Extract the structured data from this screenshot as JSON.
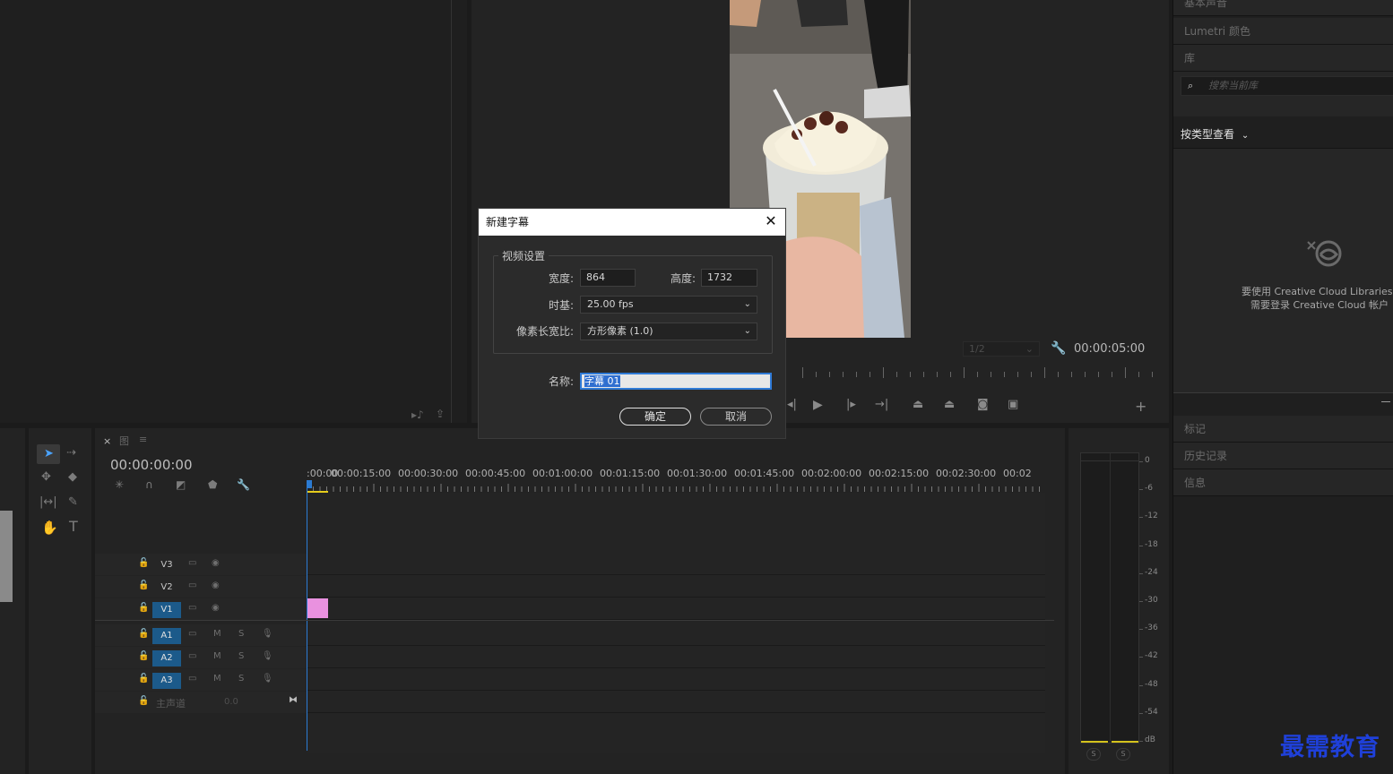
{
  "program_monitor": {
    "timecode": "00:00:05:00",
    "resolution": "1/2",
    "transport_icons": [
      "step-back-icon",
      "play-icon",
      "step-forward-icon",
      "go-to-out-icon",
      "lift-icon",
      "extract-icon",
      "camera-icon",
      "compare-icon",
      "add-icon"
    ]
  },
  "right_panel": {
    "basic_audio": "基本声音",
    "lumetri_color": "Lumetri 颜色",
    "libraries": "库",
    "search_placeholder": "搜索当前库",
    "view_by_type": "按类型查看",
    "cc_message_line1": "要使用 Creative Cloud Libraries，",
    "cc_message_line2": "需要登录 Creative Cloud 帐户",
    "markers": "标记",
    "history": "历史记录",
    "info": "信息"
  },
  "dialog": {
    "title": "新建字幕",
    "group_title": "视频设置",
    "width_label": "宽度:",
    "width_value": "864",
    "height_label": "高度:",
    "height_value": "1732",
    "timebase_label": "时基:",
    "timebase_value": "25.00 fps",
    "par_label": "像素长宽比:",
    "par_value": "方形像素 (1.0)",
    "name_label": "名称:",
    "name_value": "字幕 01",
    "ok_label": "确定",
    "cancel_label": "取消"
  },
  "timeline": {
    "timecode": "00:00:00:00",
    "ruler": [
      ":00:00",
      "00:00:15:00",
      "00:00:30:00",
      "00:00:45:00",
      "00:01:00:00",
      "00:01:15:00",
      "00:01:30:00",
      "00:01:45:00",
      "00:02:00:00",
      "00:02:15:00",
      "00:02:30:00",
      "00:02"
    ],
    "video_tracks": [
      "V3",
      "V2",
      "V1"
    ],
    "audio_tracks": [
      "A1",
      "A2",
      "A3"
    ],
    "master_label": "主声道",
    "master_value": "0.0",
    "mute": "M",
    "solo": "S"
  },
  "meter": {
    "scale": [
      "0",
      "-6",
      "-12",
      "-18",
      "-24",
      "-30",
      "-36",
      "-42",
      "-48",
      "-54",
      "dB"
    ],
    "solo_buttons": [
      "S",
      "S"
    ]
  },
  "watermark": "最需教育",
  "colors": {
    "accent_blue": "#2b7bd3",
    "clip_pink": "#e991df",
    "track_on": "#1c5a8a",
    "work_area": "#e5cc1b"
  }
}
